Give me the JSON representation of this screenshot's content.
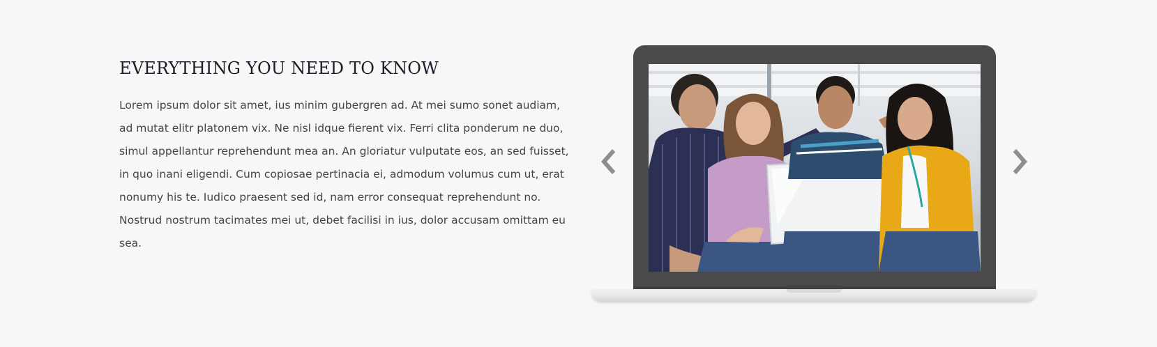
{
  "section": {
    "heading": "EVERYTHING YOU NEED TO KNOW",
    "body": "Lorem ipsum dolor sit amet, ius minim gubergren ad. At mei sumo sonet audiam, ad mutat elitr platonem vix. Ne nisl idque fierent vix. Ferri clita ponderum ne duo, simul appellantur reprehendunt mea an. An gloriatur vulputate eos, an sed fuisset, in quo inani eligendi. Cum copiosae pertinacia ei, admodum volumus cum ut, erat nonumy his te. Iudico praesent sed id, nam error consequat reprehendunt no. Nostrud nostrum tacimates mei ut, debet facilisi in ius, dolor accusam omittam eu sea."
  },
  "slider": {
    "prev_icon": "chevron-left-icon",
    "next_icon": "chevron-right-icon",
    "slide_image": "group-of-four-students-with-laptop-photo"
  },
  "colors": {
    "background": "#f7f7f7",
    "heading": "#1c1c2a",
    "body_text": "#444444",
    "arrow": "#8e8e8e",
    "laptop_frame": "#4a4a4a",
    "laptop_base": "#e6e6e6"
  }
}
